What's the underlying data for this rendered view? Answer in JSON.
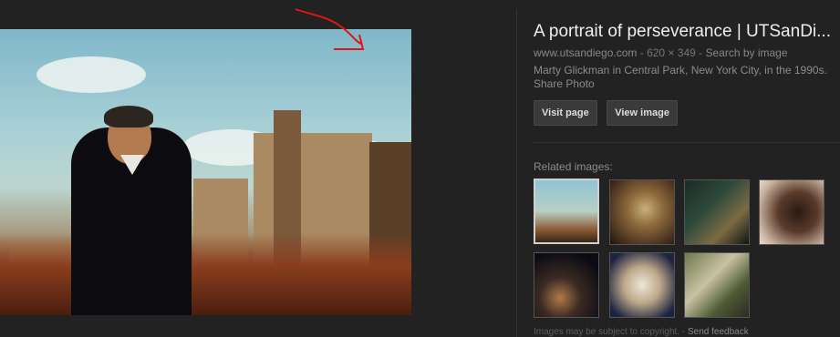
{
  "preview": {
    "alt": "Marty Glickman in Central Park"
  },
  "result": {
    "title": "A portrait of perseverance | UTSanDi...",
    "site": "www.utsandiego.com",
    "dimensions": "620 × 349",
    "search_by_image": "Search by image",
    "separator": "-",
    "description": "Marty Glickman in Central Park, New York City, in the 1990s.",
    "share": "Share Photo"
  },
  "buttons": {
    "visit_page": "Visit page",
    "view_image": "View image"
  },
  "related": {
    "label": "Related images:"
  },
  "footer": {
    "notice": "Images may be subject to copyright.",
    "sep": "-",
    "feedback": "Send feedback"
  },
  "colors": {
    "background": "#222222",
    "annotation_arrow": "#e01616"
  }
}
